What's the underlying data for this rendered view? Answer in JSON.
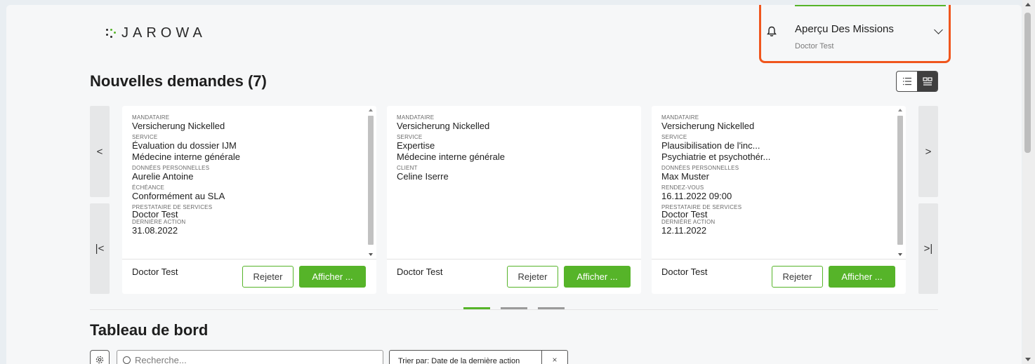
{
  "app": {
    "logo_text": "JAROWA",
    "brand_color": "#56b429",
    "highlight_color": "#f0561d"
  },
  "header": {
    "notification_icon": "bell-icon",
    "menu_title": "Aperçu Des Missions",
    "menu_subtitle": "Doctor Test",
    "menu_icon": "chevron-down-icon"
  },
  "new_requests": {
    "title": "Nouvelles demandes (7)",
    "view_list_icon": "list-view-icon",
    "view_grid_icon": "grid-view-icon",
    "nav": {
      "prev": "<",
      "first": "|<",
      "next": ">",
      "last": ">|"
    },
    "cards": [
      {
        "fields": [
          {
            "label": "MANDATAIRE",
            "value": "Versicherung Nickelled"
          },
          {
            "label": "SERVICE",
            "value": "Évaluation du dossier IJM",
            "value2": "Médecine interne générale"
          },
          {
            "label": "DONNÉES PERSONNELLES",
            "value": "Aurelie Antoine"
          },
          {
            "label": "ÉCHÉANCE",
            "value": "Conformément au SLA"
          },
          {
            "label": "PRESTATAIRE DE SERVICES",
            "value": "Doctor  Test"
          },
          {
            "label": "DERNIÈRE ACTION",
            "value": "31.08.2022"
          }
        ],
        "footer_name": "Doctor Test",
        "reject_label": "Rejeter",
        "show_label": "Afficher ..."
      },
      {
        "fields": [
          {
            "label": "MANDATAIRE",
            "value": "Versicherung Nickelled"
          },
          {
            "label": "SERVICE",
            "value": "Expertise",
            "value2": "Médecine interne générale"
          },
          {
            "label": "CLIENT",
            "value": "Celine Iserre"
          }
        ],
        "footer_name": "Doctor Test",
        "reject_label": "Rejeter",
        "show_label": "Afficher ..."
      },
      {
        "fields": [
          {
            "label": "MANDATAIRE",
            "value": "Versicherung Nickelled"
          },
          {
            "label": "SERVICE",
            "value": "Plausibilisation de l'inc...",
            "value2": "Psychiatrie et psychothér..."
          },
          {
            "label": "DONNÉES PERSONNELLES",
            "value": "Max Muster"
          },
          {
            "label": "RENDEZ-VOUS",
            "value": "16.11.2022 09:00"
          },
          {
            "label": "PRESTATAIRE DE SERVICES",
            "value": "Doctor  Test"
          },
          {
            "label": "DERNIÈRE ACTION",
            "value": "12.11.2022"
          }
        ],
        "footer_name": "Doctor Test",
        "reject_label": "Rejeter",
        "show_label": "Afficher ..."
      }
    ],
    "pagination": {
      "pages": 3,
      "active": 0
    }
  },
  "dashboard": {
    "title": "Tableau de bord",
    "settings_icon": "gear-icon",
    "search_placeholder": "Recherche...",
    "sort_label": "Trier par: Date de la dernière action",
    "sort_clear": "×"
  }
}
